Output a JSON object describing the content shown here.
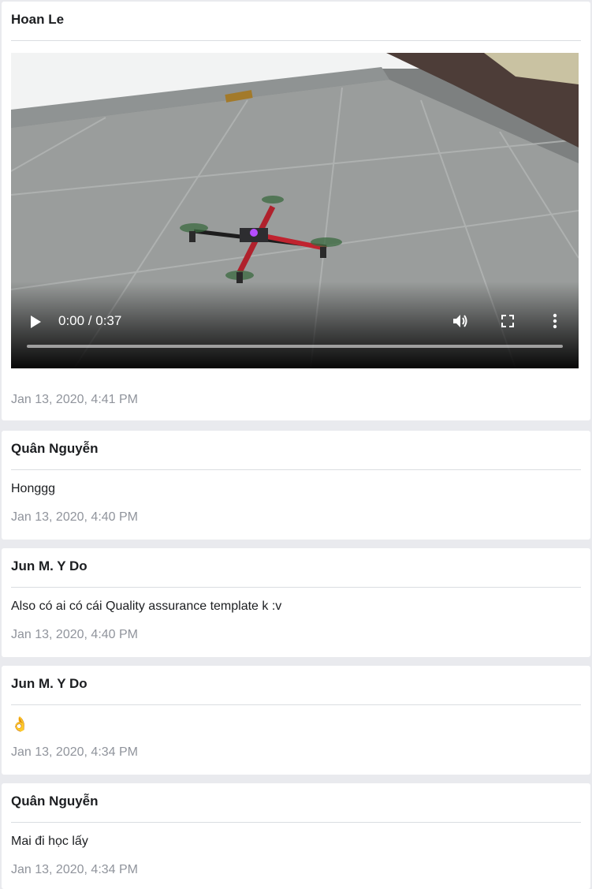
{
  "posts": [
    {
      "author": "Hoan Le",
      "video": {
        "current_time": "0:00",
        "duration": "0:37",
        "time_label": "0:00 / 0:37",
        "progress": 0
      },
      "timestamp": "Jan 13, 2020, 4:41 PM"
    },
    {
      "author": "Quân Nguyễn",
      "message": "Honggg",
      "timestamp": "Jan 13, 2020, 4:40 PM"
    },
    {
      "author": "Jun M. Y Do",
      "message": "Also có ai có cái Quality assurance template k :v",
      "timestamp": "Jan 13, 2020, 4:40 PM"
    },
    {
      "author": "Jun M. Y Do",
      "message": "👌",
      "timestamp": "Jan 13, 2020, 4:34 PM"
    },
    {
      "author": "Quân Nguyễn",
      "message": "Mai đi học lấy",
      "timestamp": "Jan 13, 2020, 4:34 PM"
    }
  ],
  "icons": {
    "play": "play-icon",
    "volume": "volume-icon",
    "fullscreen": "fullscreen-icon",
    "more": "more-vertical-icon"
  }
}
